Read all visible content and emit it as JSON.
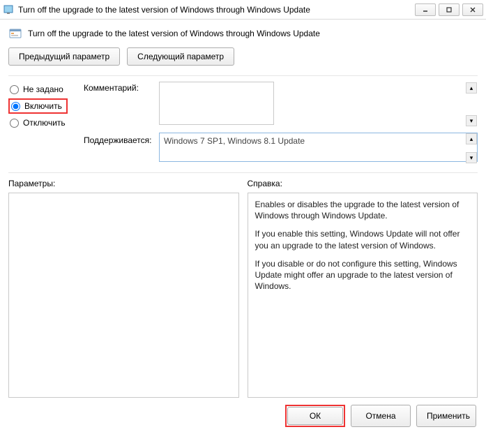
{
  "window": {
    "title": "Turn off the upgrade to the latest version of Windows through Windows Update"
  },
  "header": {
    "title": "Turn off the upgrade to the latest version of Windows through Windows Update"
  },
  "nav": {
    "prev": "Предыдущий параметр",
    "next": "Следующий параметр"
  },
  "radios": {
    "not_configured": "Не задано",
    "enabled": "Включить",
    "disabled": "Отключить",
    "selected": "enabled"
  },
  "labels": {
    "comment": "Комментарий:",
    "supported": "Поддерживается:",
    "options": "Параметры:",
    "help": "Справка:"
  },
  "comment": {
    "value": ""
  },
  "supported": {
    "value": "Windows 7 SP1, Windows 8.1 Update"
  },
  "options": {
    "value": ""
  },
  "help": {
    "p1": "Enables or disables the upgrade to the latest version of Windows through Windows Update.",
    "p2": "If you enable this setting, Windows Update will not offer you an upgrade to the latest version of Windows.",
    "p3": "If you disable or do not configure this setting, Windows Update might offer an upgrade to the latest version of Windows."
  },
  "footer": {
    "ok": "ОК",
    "cancel": "Отмена",
    "apply": "Применить"
  }
}
